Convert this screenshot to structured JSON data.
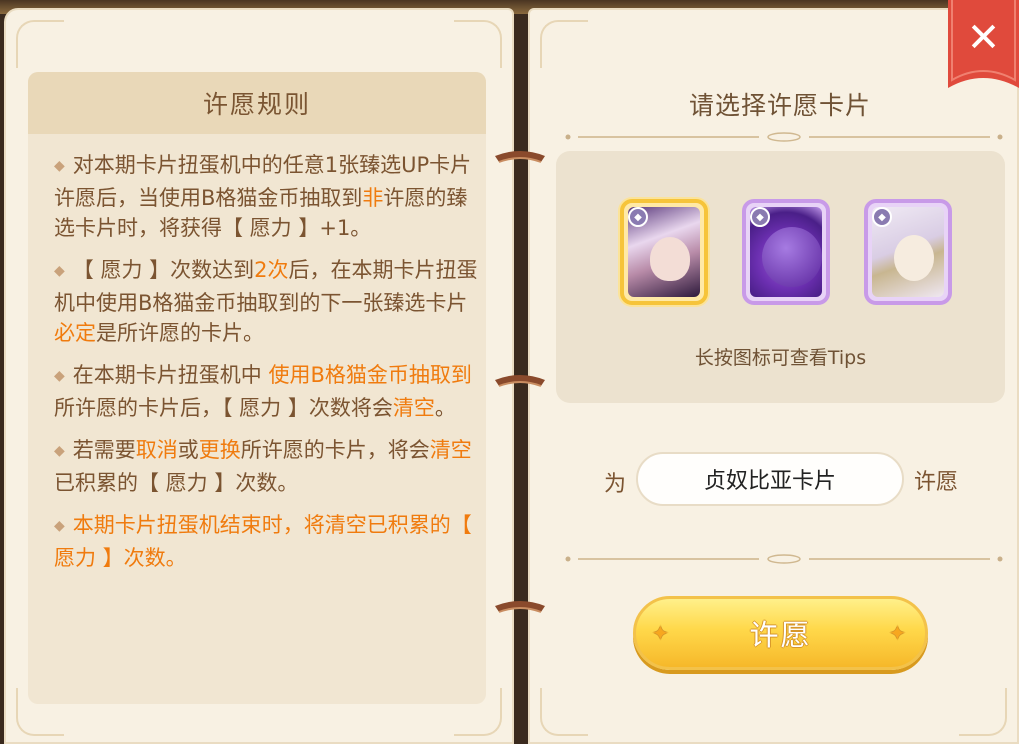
{
  "close_icon": "close-x-icon",
  "left": {
    "title": "许愿规则",
    "rules": [
      {
        "segments": [
          {
            "t": "对本期卡片扭蛋机中的任意1张臻选UP卡片许愿后，当使用B格猫金币抽取到",
            "h": false
          },
          {
            "t": "非",
            "h": true
          },
          {
            "t": "许愿的臻选卡片时，将获得【 愿力 】+1。",
            "h": false
          }
        ]
      },
      {
        "segments": [
          {
            "t": "【 愿力 】次数达到",
            "h": false
          },
          {
            "t": "2次",
            "h": true
          },
          {
            "t": "后，在本期卡片扭蛋机中使用B格猫金币抽取到的下一张臻选卡片",
            "h": false
          },
          {
            "t": "必定",
            "h": true
          },
          {
            "t": "是所许愿的卡片。",
            "h": false
          }
        ]
      },
      {
        "segments": [
          {
            "t": "在本期卡片扭蛋机中 ",
            "h": false
          },
          {
            "t": "使用B格猫金币抽取到",
            "h": true
          },
          {
            "t": "所许愿的卡片后，【 愿力 】次数将会",
            "h": false
          },
          {
            "t": "清空",
            "h": true
          },
          {
            "t": "。",
            "h": false
          }
        ]
      },
      {
        "segments": [
          {
            "t": "若需要",
            "h": false
          },
          {
            "t": "取消",
            "h": true
          },
          {
            "t": "或",
            "h": false
          },
          {
            "t": "更换",
            "h": true
          },
          {
            "t": "所许愿的卡片，将会",
            "h": false
          },
          {
            "t": "清空",
            "h": true
          },
          {
            "t": "已积累的【 愿力 】次数。",
            "h": false
          }
        ]
      },
      {
        "segments": [
          {
            "t": "本期卡片扭蛋机结束时，将清空已积累的【 愿力 】次数。",
            "h": true
          }
        ]
      }
    ]
  },
  "right": {
    "title": "请选择许愿卡片",
    "cards": [
      {
        "name": "card-1",
        "selected": true
      },
      {
        "name": "card-2",
        "selected": false
      },
      {
        "name": "card-3",
        "selected": false
      }
    ],
    "tips": "长按图标可查看Tips",
    "wish_prefix": "为",
    "wish_value": "贞奴比亚卡片",
    "wish_suffix": "许愿",
    "wish_button": "许愿"
  },
  "colors": {
    "highlight": "#f07b0e",
    "text": "#7b5431",
    "close_red": "#e04a3c",
    "button_gold": "#ffd84a"
  }
}
